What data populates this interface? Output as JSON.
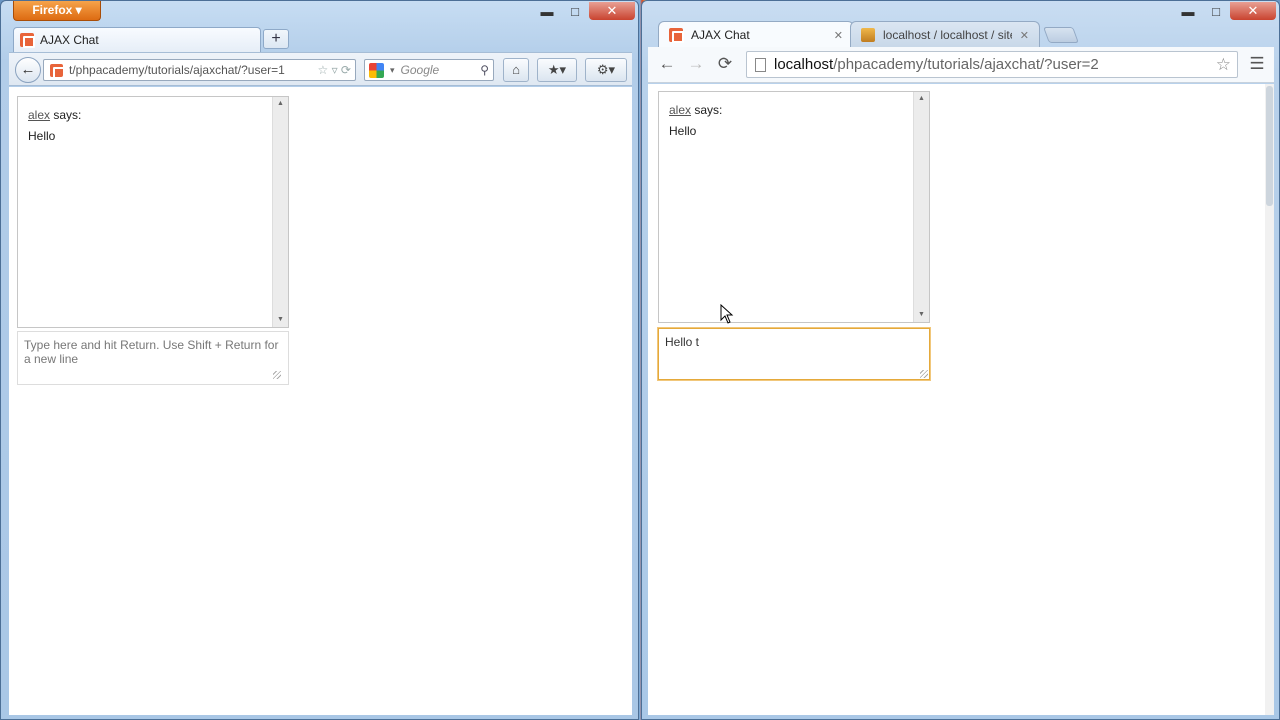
{
  "left_window": {
    "app_button": "Firefox ▾",
    "tab_title": "AJAX Chat",
    "new_tab_label": "+",
    "url_text": "t/phpacademy/tutorials/ajaxchat/?user=1",
    "search_placeholder": "Google",
    "chat": {
      "messages": [
        {
          "user": "alex",
          "says": "says:",
          "text": "Hello"
        }
      ],
      "input_value": "",
      "input_placeholder": "Type here and hit Return. Use Shift + Return for a new line"
    }
  },
  "right_window": {
    "tabs": [
      {
        "title": "AJAX Chat",
        "active": true
      },
      {
        "title": "localhost / localhost / site",
        "active": false
      }
    ],
    "url_host": "localhost",
    "url_path": "/phpacademy/tutorials/ajaxchat/?user=2",
    "chat": {
      "messages": [
        {
          "user": "alex",
          "says": "says:",
          "text": "Hello"
        }
      ],
      "input_value": "Hello t"
    }
  },
  "colors": {
    "firefox_orange": "#dd6b12",
    "focus_outline": "#e5a93a",
    "close_red": "#c9432f"
  },
  "icons": [
    "back-arrow-icon",
    "forward-arrow-icon",
    "reload-icon",
    "star-icon",
    "home-icon",
    "bookmarks-icon",
    "search-icon",
    "menu-icon",
    "minimize-icon",
    "maximize-icon",
    "close-icon"
  ]
}
